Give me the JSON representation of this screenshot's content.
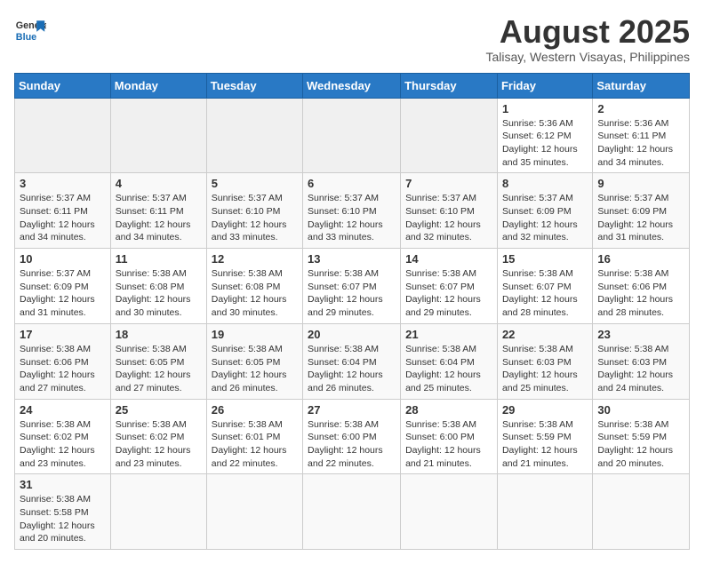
{
  "header": {
    "logo_general": "General",
    "logo_blue": "Blue",
    "title": "August 2025",
    "subtitle": "Talisay, Western Visayas, Philippines"
  },
  "days_of_week": [
    "Sunday",
    "Monday",
    "Tuesday",
    "Wednesday",
    "Thursday",
    "Friday",
    "Saturday"
  ],
  "weeks": [
    [
      {
        "day": "",
        "info": ""
      },
      {
        "day": "",
        "info": ""
      },
      {
        "day": "",
        "info": ""
      },
      {
        "day": "",
        "info": ""
      },
      {
        "day": "",
        "info": ""
      },
      {
        "day": "1",
        "info": "Sunrise: 5:36 AM\nSunset: 6:12 PM\nDaylight: 12 hours and 35 minutes."
      },
      {
        "day": "2",
        "info": "Sunrise: 5:36 AM\nSunset: 6:11 PM\nDaylight: 12 hours and 34 minutes."
      }
    ],
    [
      {
        "day": "3",
        "info": "Sunrise: 5:37 AM\nSunset: 6:11 PM\nDaylight: 12 hours and 34 minutes."
      },
      {
        "day": "4",
        "info": "Sunrise: 5:37 AM\nSunset: 6:11 PM\nDaylight: 12 hours and 34 minutes."
      },
      {
        "day": "5",
        "info": "Sunrise: 5:37 AM\nSunset: 6:10 PM\nDaylight: 12 hours and 33 minutes."
      },
      {
        "day": "6",
        "info": "Sunrise: 5:37 AM\nSunset: 6:10 PM\nDaylight: 12 hours and 33 minutes."
      },
      {
        "day": "7",
        "info": "Sunrise: 5:37 AM\nSunset: 6:10 PM\nDaylight: 12 hours and 32 minutes."
      },
      {
        "day": "8",
        "info": "Sunrise: 5:37 AM\nSunset: 6:09 PM\nDaylight: 12 hours and 32 minutes."
      },
      {
        "day": "9",
        "info": "Sunrise: 5:37 AM\nSunset: 6:09 PM\nDaylight: 12 hours and 31 minutes."
      }
    ],
    [
      {
        "day": "10",
        "info": "Sunrise: 5:37 AM\nSunset: 6:09 PM\nDaylight: 12 hours and 31 minutes."
      },
      {
        "day": "11",
        "info": "Sunrise: 5:38 AM\nSunset: 6:08 PM\nDaylight: 12 hours and 30 minutes."
      },
      {
        "day": "12",
        "info": "Sunrise: 5:38 AM\nSunset: 6:08 PM\nDaylight: 12 hours and 30 minutes."
      },
      {
        "day": "13",
        "info": "Sunrise: 5:38 AM\nSunset: 6:07 PM\nDaylight: 12 hours and 29 minutes."
      },
      {
        "day": "14",
        "info": "Sunrise: 5:38 AM\nSunset: 6:07 PM\nDaylight: 12 hours and 29 minutes."
      },
      {
        "day": "15",
        "info": "Sunrise: 5:38 AM\nSunset: 6:07 PM\nDaylight: 12 hours and 28 minutes."
      },
      {
        "day": "16",
        "info": "Sunrise: 5:38 AM\nSunset: 6:06 PM\nDaylight: 12 hours and 28 minutes."
      }
    ],
    [
      {
        "day": "17",
        "info": "Sunrise: 5:38 AM\nSunset: 6:06 PM\nDaylight: 12 hours and 27 minutes."
      },
      {
        "day": "18",
        "info": "Sunrise: 5:38 AM\nSunset: 6:05 PM\nDaylight: 12 hours and 27 minutes."
      },
      {
        "day": "19",
        "info": "Sunrise: 5:38 AM\nSunset: 6:05 PM\nDaylight: 12 hours and 26 minutes."
      },
      {
        "day": "20",
        "info": "Sunrise: 5:38 AM\nSunset: 6:04 PM\nDaylight: 12 hours and 26 minutes."
      },
      {
        "day": "21",
        "info": "Sunrise: 5:38 AM\nSunset: 6:04 PM\nDaylight: 12 hours and 25 minutes."
      },
      {
        "day": "22",
        "info": "Sunrise: 5:38 AM\nSunset: 6:03 PM\nDaylight: 12 hours and 25 minutes."
      },
      {
        "day": "23",
        "info": "Sunrise: 5:38 AM\nSunset: 6:03 PM\nDaylight: 12 hours and 24 minutes."
      }
    ],
    [
      {
        "day": "24",
        "info": "Sunrise: 5:38 AM\nSunset: 6:02 PM\nDaylight: 12 hours and 23 minutes."
      },
      {
        "day": "25",
        "info": "Sunrise: 5:38 AM\nSunset: 6:02 PM\nDaylight: 12 hours and 23 minutes."
      },
      {
        "day": "26",
        "info": "Sunrise: 5:38 AM\nSunset: 6:01 PM\nDaylight: 12 hours and 22 minutes."
      },
      {
        "day": "27",
        "info": "Sunrise: 5:38 AM\nSunset: 6:00 PM\nDaylight: 12 hours and 22 minutes."
      },
      {
        "day": "28",
        "info": "Sunrise: 5:38 AM\nSunset: 6:00 PM\nDaylight: 12 hours and 21 minutes."
      },
      {
        "day": "29",
        "info": "Sunrise: 5:38 AM\nSunset: 5:59 PM\nDaylight: 12 hours and 21 minutes."
      },
      {
        "day": "30",
        "info": "Sunrise: 5:38 AM\nSunset: 5:59 PM\nDaylight: 12 hours and 20 minutes."
      }
    ],
    [
      {
        "day": "31",
        "info": "Sunrise: 5:38 AM\nSunset: 5:58 PM\nDaylight: 12 hours and 20 minutes."
      },
      {
        "day": "",
        "info": ""
      },
      {
        "day": "",
        "info": ""
      },
      {
        "day": "",
        "info": ""
      },
      {
        "day": "",
        "info": ""
      },
      {
        "day": "",
        "info": ""
      },
      {
        "day": "",
        "info": ""
      }
    ]
  ]
}
